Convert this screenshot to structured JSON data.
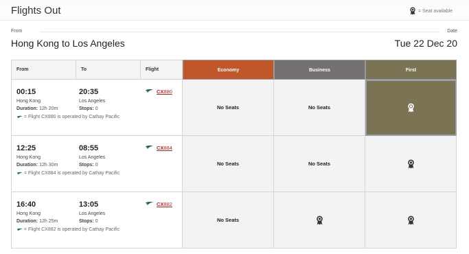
{
  "header": {
    "title": "Flights Out",
    "legend": {
      "icon": "seat-available-icon",
      "label": "= Seat available"
    }
  },
  "route": {
    "from_label": "From",
    "date_label": "Date",
    "route": "Hong Kong to Los Angeles",
    "date": "Tue 22 Dec 20"
  },
  "table": {
    "columns": {
      "from": "From",
      "to": "To",
      "flight": "Flight",
      "economy": "Economy",
      "business": "Business",
      "first": "First"
    },
    "colors": {
      "economy": "#c1562a",
      "business": "#757070",
      "first": "#7a7455",
      "flight_link": "#c1251f"
    }
  },
  "flights": [
    {
      "dep_time": "00:15",
      "arr_time": "20:35",
      "from_city": "Hong Kong",
      "to_city": "Los Angeles",
      "duration_label": "Duration:",
      "duration": "12h 20m",
      "stops_label": "Stops:",
      "stops": "0",
      "operated": "= Flight CX880 is operated by Cathay Pacific",
      "flight_code": "CX",
      "flight_num": "880",
      "economy": "No Seats",
      "business": "No Seats",
      "first": "available",
      "selected": "first"
    },
    {
      "dep_time": "12:25",
      "arr_time": "08:55",
      "from_city": "Hong Kong",
      "to_city": "Los Angeles",
      "duration_label": "Duration:",
      "duration": "12h 30m",
      "stops_label": "Stops:",
      "stops": "0",
      "operated": "= Flight CX884 is operated by Cathay Pacific",
      "flight_code": "CX",
      "flight_num": "884",
      "economy": "No Seats",
      "business": "No Seats",
      "first": "available"
    },
    {
      "dep_time": "16:40",
      "arr_time": "13:05",
      "from_city": "Hong Kong",
      "to_city": "Los Angeles",
      "duration_label": "Duration:",
      "duration": "12h 25m",
      "stops_label": "Stops:",
      "stops": "0",
      "operated": "= Flight CX882 is operated by Cathay Pacific",
      "flight_code": "CX",
      "flight_num": "882",
      "economy": "No Seats",
      "business": "available",
      "first": "available"
    }
  ]
}
